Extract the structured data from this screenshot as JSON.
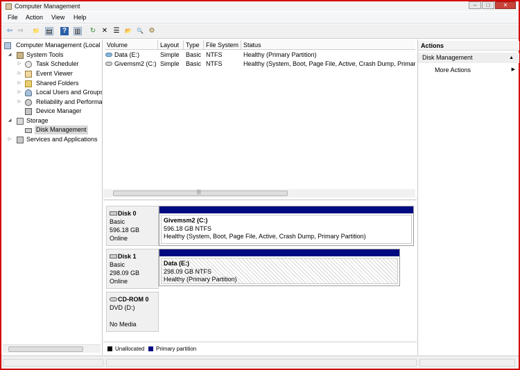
{
  "window": {
    "title": "Computer Management",
    "minimize": "–",
    "maximize": "□",
    "close": "✕"
  },
  "menu": [
    "File",
    "Action",
    "View",
    "Help"
  ],
  "toolbar": {
    "icons": [
      "back-icon",
      "forward-icon",
      "up-folder-icon",
      "show-hide-tree-icon",
      "help-icon",
      "show-hide-action-pane-icon",
      "refresh-icon",
      "delete-icon",
      "properties-icon",
      "open-icon",
      "search-icon",
      "wizard-icon"
    ],
    "glyphs": [
      "⇦",
      "⇨",
      "📁",
      "▤",
      "?",
      "▥",
      "↻",
      "✕",
      "☰",
      "📂",
      "🔍",
      "⚙"
    ]
  },
  "tree": {
    "root": "Computer Management (Local",
    "system_tools": "System Tools",
    "task_scheduler": "Task Scheduler",
    "event_viewer": "Event Viewer",
    "shared_folders": "Shared Folders",
    "local_users": "Local Users and Groups",
    "reliability": "Reliability and Performa",
    "device_manager": "Device Manager",
    "storage": "Storage",
    "disk_management": "Disk Management",
    "services": "Services and Applications"
  },
  "volume_table": {
    "columns": [
      "Volume",
      "Layout",
      "Type",
      "File System",
      "Status"
    ],
    "rows": [
      [
        "Data (E:)",
        "Simple",
        "Basic",
        "NTFS",
        "Healthy (Primary Partition)"
      ],
      [
        "Givemsm2 (C:)",
        "Simple",
        "Basic",
        "NTFS",
        "Healthy (System, Boot, Page File, Active, Crash Dump, Primary"
      ]
    ],
    "scroll_grip": "|||"
  },
  "disks": {
    "disk0": {
      "name": "Disk 0",
      "type": "Basic",
      "size": "596.18 GB",
      "state": "Online",
      "partition": {
        "name": "Givemsm2  (C:)",
        "size": "596.18 GB NTFS",
        "status": "Healthy (System, Boot, Page File, Active, Crash Dump, Primary Partition)"
      }
    },
    "disk1": {
      "name": "Disk 1",
      "type": "Basic",
      "size": "298.09 GB",
      "state": "Online",
      "partition": {
        "name": "Data  (E:)",
        "size": "298.09 GB NTFS",
        "status": "Healthy (Primary Partition)"
      }
    },
    "cdrom0": {
      "name": "CD-ROM 0",
      "type": "DVD (D:)",
      "media": "No Media"
    }
  },
  "legend": {
    "unallocated": "Unallocated",
    "unallocated_color": "#000000",
    "primary": "Primary partition",
    "primary_color": "#000a80"
  },
  "actions": {
    "header": "Actions",
    "section": "Disk Management",
    "more": "More Actions",
    "collapse": "▲",
    "more_arrow": "▶"
  }
}
